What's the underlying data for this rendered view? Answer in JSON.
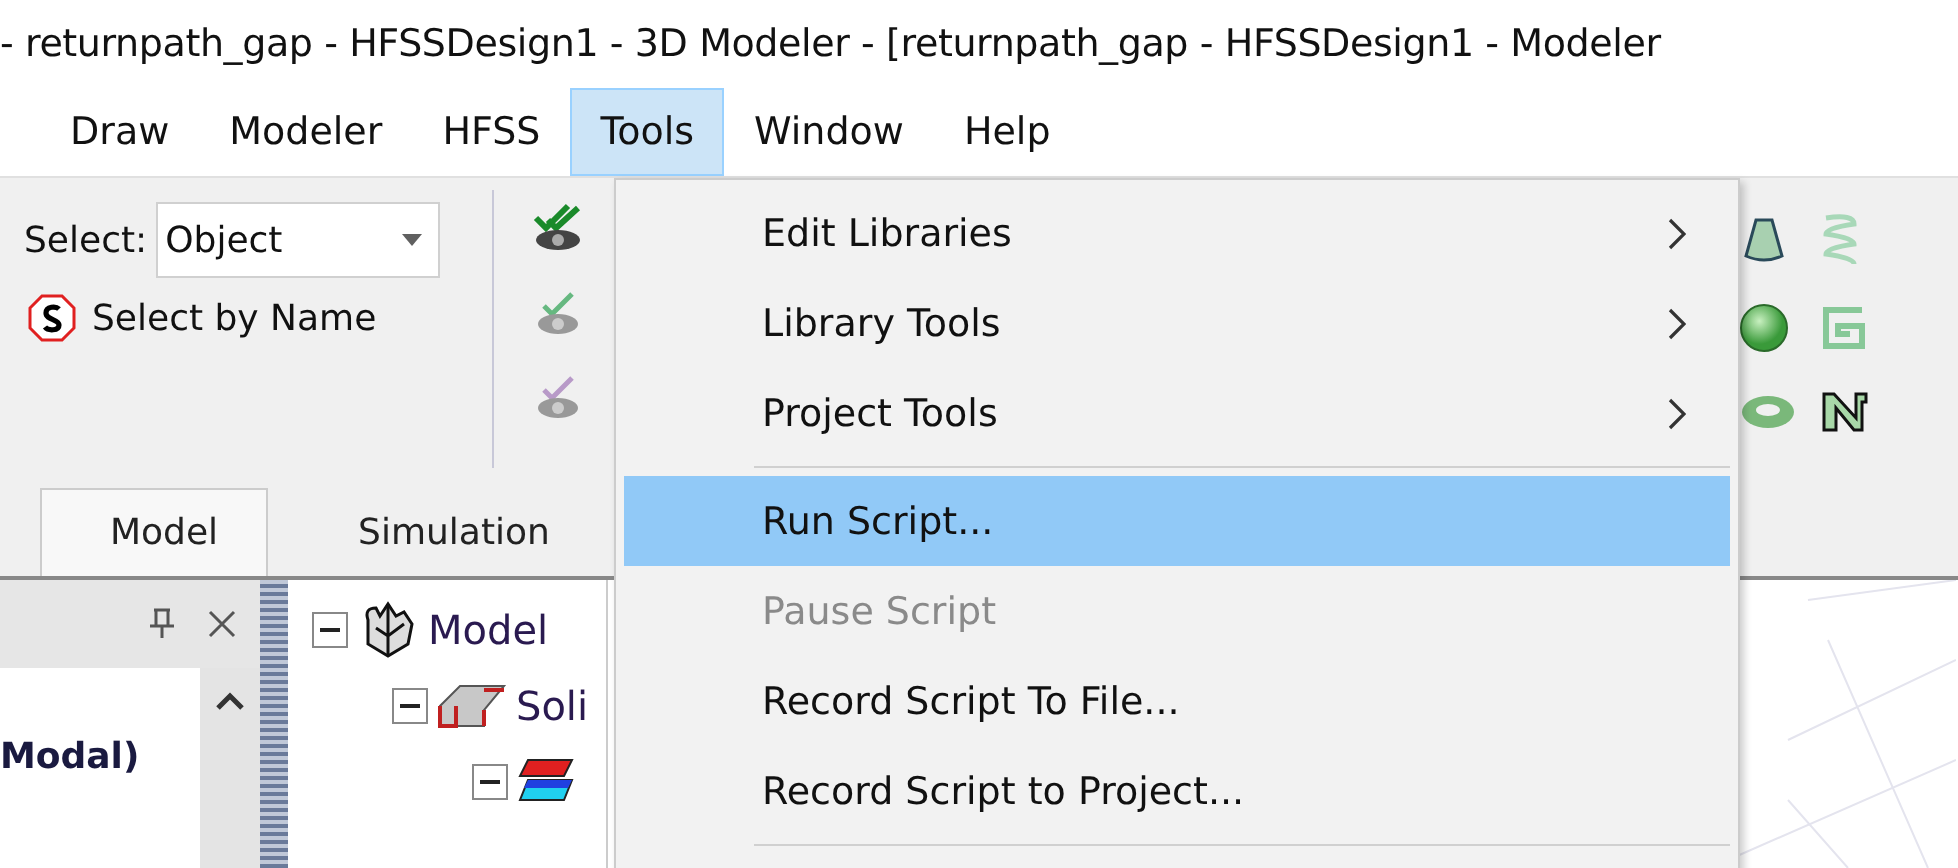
{
  "window": {
    "title": "- returnpath_gap - HFSSDesign1 - 3D Modeler - [returnpath_gap - HFSSDesign1 - Modeler"
  },
  "menubar": [
    {
      "label": "Draw",
      "selected": false
    },
    {
      "label": "Modeler",
      "selected": false
    },
    {
      "label": "HFSS",
      "selected": false
    },
    {
      "label": "Tools",
      "selected": true
    },
    {
      "label": "Window",
      "selected": false
    },
    {
      "label": "Help",
      "selected": false
    }
  ],
  "ribbon": {
    "select_label": "Select:",
    "select_value": "Object",
    "select_by_name": "Select by Name"
  },
  "ribbon_tabs": [
    {
      "label": "Model",
      "selected": true
    },
    {
      "label": "Simulation",
      "selected": false
    }
  ],
  "left_panel": {
    "text": "Modal)"
  },
  "tree": [
    {
      "label": "Model",
      "expanded": true,
      "children": [
        {
          "label": "Soli",
          "expanded": true
        }
      ]
    }
  ],
  "menu": [
    {
      "kind": "item",
      "label": "Edit Libraries",
      "submenu": true,
      "selected": false,
      "disabled": false
    },
    {
      "kind": "item",
      "label": "Library Tools",
      "submenu": true,
      "selected": false,
      "disabled": false
    },
    {
      "kind": "item",
      "label": "Project Tools",
      "submenu": true,
      "selected": false,
      "disabled": false
    },
    {
      "kind": "separator"
    },
    {
      "kind": "item",
      "label": "Run Script...",
      "submenu": false,
      "selected": true,
      "disabled": false
    },
    {
      "kind": "item",
      "label": "Pause Script",
      "submenu": false,
      "selected": false,
      "disabled": true
    },
    {
      "kind": "item",
      "label": "Record Script To File...",
      "submenu": false,
      "selected": false,
      "disabled": false
    },
    {
      "kind": "item",
      "label": "Record Script to Project...",
      "submenu": false,
      "selected": false,
      "disabled": false
    },
    {
      "kind": "separator"
    }
  ]
}
